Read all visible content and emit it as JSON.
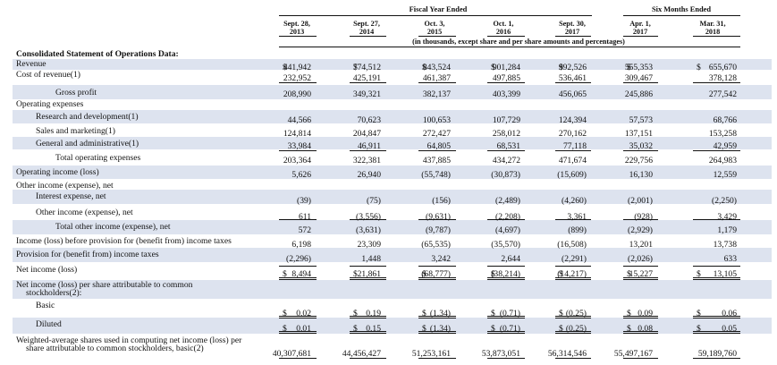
{
  "group_headers": {
    "fiscal": "Fiscal Year Ended",
    "six_months": "Six Months Ended"
  },
  "units_note": "(in thousands, except share and per share amounts and percentages)",
  "columns": [
    {
      "l1": "Sept. 28,",
      "l2": "2013"
    },
    {
      "l1": "Sept. 27,",
      "l2": "2014"
    },
    {
      "l1": "Oct. 3,",
      "l2": "2015"
    },
    {
      "l1": "Oct. 1,",
      "l2": "2016"
    },
    {
      "l1": "Sept. 30,",
      "l2": "2017"
    },
    {
      "l1": "Apr. 1,",
      "l2": "2017"
    },
    {
      "l1": "Mar. 31,",
      "l2": "2018"
    }
  ],
  "rows": [
    {
      "label": "Consolidated Statement of Operations Data:",
      "bold": true
    },
    {
      "label": "Revenue",
      "dollar": true,
      "values": [
        "441,942",
        "774,512",
        "843,524",
        "901,284",
        "992,526",
        "555,353",
        "655,670"
      ]
    },
    {
      "label": "Cost of revenue(1)",
      "values": [
        "232,952",
        "425,191",
        "461,387",
        "497,885",
        "536,461",
        "309,467",
        "378,128"
      ]
    },
    {
      "label": "Gross profit",
      "values": [
        "208,990",
        "349,321",
        "382,137",
        "403,399",
        "456,065",
        "245,886",
        "277,542"
      ]
    },
    {
      "label": "Operating expenses"
    },
    {
      "label": "Research and development(1)",
      "values": [
        "44,566",
        "70,623",
        "100,653",
        "107,729",
        "124,394",
        "57,573",
        "68,766"
      ]
    },
    {
      "label": "Sales and marketing(1)",
      "values": [
        "124,814",
        "204,847",
        "272,427",
        "258,012",
        "270,162",
        "137,151",
        "153,258"
      ]
    },
    {
      "label": "General and administrative(1)",
      "values": [
        "33,984",
        "46,911",
        "64,805",
        "68,531",
        "77,118",
        "35,032",
        "42,959"
      ]
    },
    {
      "label": "Total operating expenses",
      "values": [
        "203,364",
        "322,381",
        "437,885",
        "434,272",
        "471,674",
        "229,756",
        "264,983"
      ]
    },
    {
      "label": "Operating income (loss)",
      "values": [
        "5,626",
        "26,940",
        "(55,748)",
        "(30,873)",
        "(15,609)",
        "16,130",
        "12,559"
      ]
    },
    {
      "label": "Other income (expense), net"
    },
    {
      "label": "Interest expense, net",
      "values": [
        "(39)",
        "(75)",
        "(156)",
        "(2,489)",
        "(4,260)",
        "(2,001)",
        "(2,250)"
      ]
    },
    {
      "label": "Other income (expense), net",
      "values": [
        "611",
        "(3,556)",
        "(9,631)",
        "(2,208)",
        "3,361",
        "(928)",
        "3,429"
      ]
    },
    {
      "label": "Total other income (expense), net",
      "values": [
        "572",
        "(3,631)",
        "(9,787)",
        "(4,697)",
        "(899)",
        "(2,929)",
        "1,179"
      ]
    },
    {
      "label": "Income (loss) before provision for (benefit from) income taxes",
      "values": [
        "6,198",
        "23,309",
        "(65,535)",
        "(35,570)",
        "(16,508)",
        "13,201",
        "13,738"
      ]
    },
    {
      "label": "Provision for (benefit from) income taxes",
      "values": [
        "(2,296)",
        "1,448",
        "3,242",
        "2,644",
        "(2,291)",
        "(2,026)",
        "633"
      ]
    },
    {
      "label": "Net income (loss)",
      "dollar": true,
      "values": [
        "8,494",
        "21,861",
        "(68,777)",
        "(38,214)",
        "(14,217)",
        "15,227",
        "13,105"
      ]
    },
    {
      "label": "Net income (loss) per share attributable to common",
      "label2": "stockholders(2):"
    },
    {
      "label": "Basic",
      "dollar": true,
      "values": [
        "0.02",
        "0.19",
        "(1.34)",
        "(0.71)",
        "(0.25)",
        "0.09",
        "0.06"
      ]
    },
    {
      "label": "Diluted",
      "dollar": true,
      "values": [
        "0.01",
        "0.15",
        "(1.34)",
        "(0.71)",
        "(0.25)",
        "0.08",
        "0.05"
      ]
    },
    {
      "label": "Weighted-average shares used in computing net income (loss) per",
      "label2": "share attributable to common stockholders, basic(2)",
      "values": [
        "40,307,681",
        "44,456,427",
        "51,253,161",
        "53,873,051",
        "56,314,546",
        "55,497,167",
        "59,189,760"
      ]
    }
  ]
}
